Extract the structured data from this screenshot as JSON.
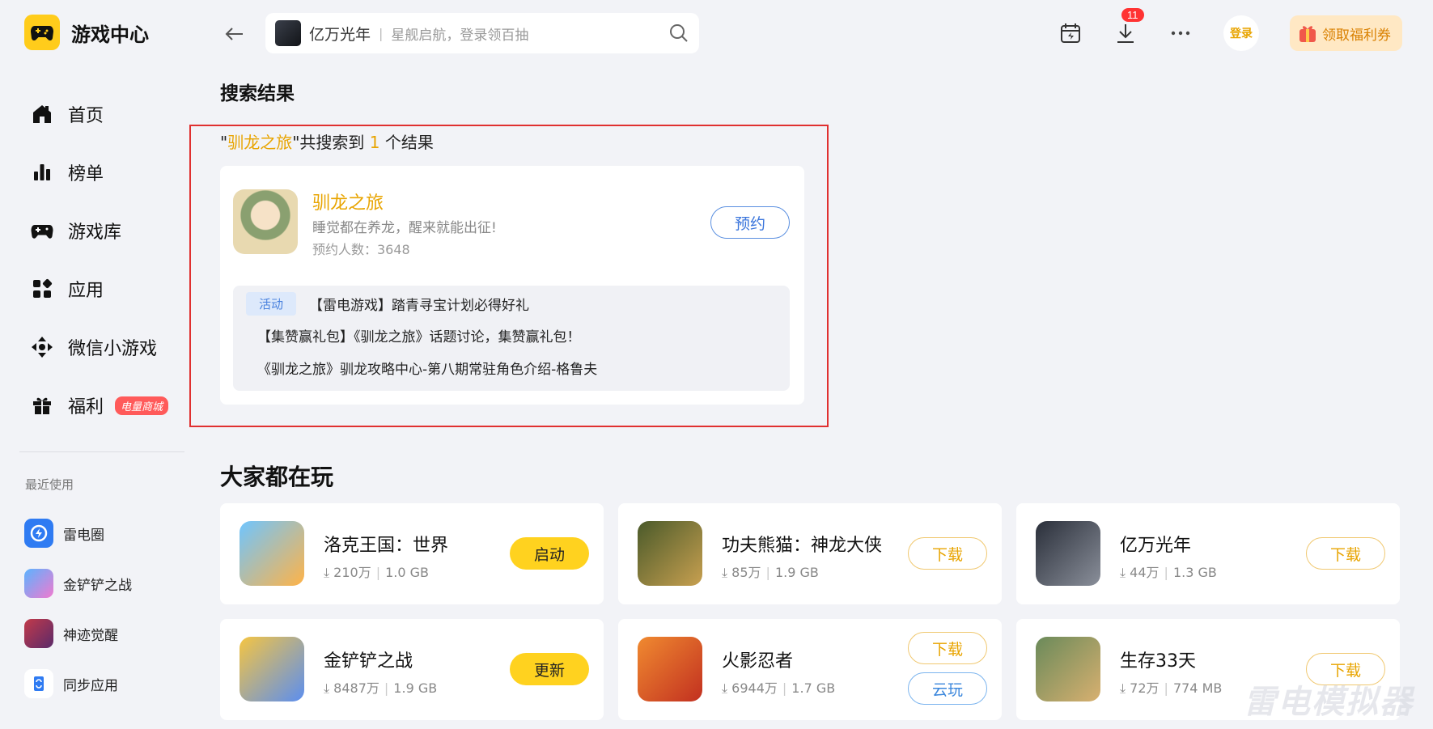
{
  "app": {
    "title": "游戏中心"
  },
  "sidebar": {
    "items": [
      {
        "label": "首页",
        "icon": "home-icon"
      },
      {
        "label": "榜单",
        "icon": "ranking-icon"
      },
      {
        "label": "游戏库",
        "icon": "gamepad-icon"
      },
      {
        "label": "应用",
        "icon": "apps-icon"
      },
      {
        "label": "微信小游戏",
        "icon": "wechat-game-icon"
      },
      {
        "label": "福利",
        "icon": "gift-icon",
        "badge": "电量商城"
      }
    ],
    "recent_title": "最近使用",
    "recent": [
      {
        "label": "雷电圈"
      },
      {
        "label": "金铲铲之战"
      },
      {
        "label": "神迹觉醒"
      },
      {
        "label": "同步应用"
      }
    ]
  },
  "search": {
    "game": "亿万光年",
    "hint": "星舰启航，登录领百抽"
  },
  "topbar": {
    "download_count": "11",
    "login_label": "登录",
    "coupon_label": "领取福利券"
  },
  "results": {
    "section_title": "搜索结果",
    "summary_prefix": "\"",
    "query": "驯龙之旅",
    "summary_mid": "\"共搜索到 ",
    "count": "1",
    "summary_suffix": " 个结果",
    "game": {
      "name": "驯龙之旅",
      "desc": "睡觉都在养龙，醒来就能出征!",
      "reserve_count": "预约人数：3648",
      "button": "预约"
    },
    "activity_tag": "活动",
    "activities": [
      "【雷电游戏】踏青寻宝计划必得好礼",
      "【集赞赢礼包】《驯龙之旅》话题讨论，集赞赢礼包！",
      "《驯龙之旅》驯龙攻略中心-第八期常驻角色介绍-格鲁夫"
    ]
  },
  "popular": {
    "title": "大家都在玩",
    "games": [
      {
        "name": "洛克王国：世界",
        "downloads": "210万",
        "size": "1.0 GB",
        "button": "启动"
      },
      {
        "name": "功夫熊猫：神龙大侠",
        "downloads": "85万",
        "size": "1.9 GB",
        "button": "下载"
      },
      {
        "name": "亿万光年",
        "downloads": "44万",
        "size": "1.3 GB",
        "button": "下载"
      },
      {
        "name": "金铲铲之战",
        "downloads": "8487万",
        "size": "1.9 GB",
        "button": "更新"
      },
      {
        "name": "火影忍者",
        "downloads": "6944万",
        "size": "1.7 GB",
        "button": "下载",
        "button2": "云玩"
      },
      {
        "name": "生存33天",
        "downloads": "72万",
        "size": "774 MB",
        "button": "下载"
      }
    ]
  },
  "watermark": "雷电模拟器",
  "colors": {
    "accent": "#ffd21f",
    "highlight": "#e8a400",
    "link_blue": "#3a75dc",
    "frame_red": "#e03030"
  }
}
